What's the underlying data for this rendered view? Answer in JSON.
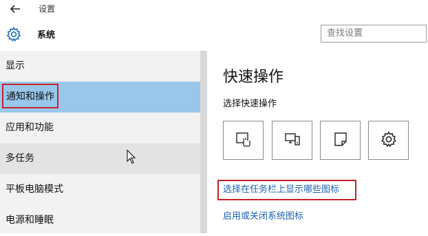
{
  "window": {
    "title": "设置"
  },
  "header": {
    "title": "系统",
    "search_placeholder": "查找设置"
  },
  "sidebar": {
    "items": [
      {
        "label": "显示"
      },
      {
        "label": "通知和操作"
      },
      {
        "label": "应用和功能"
      },
      {
        "label": "多任务"
      },
      {
        "label": "平板电脑模式"
      },
      {
        "label": "电源和睡眠"
      }
    ],
    "selected_index": 1,
    "hover_index": 3
  },
  "main": {
    "title": "快速操作",
    "quick_actions_label": "选择快速操作",
    "quick_actions": [
      {
        "icon": "tablet-mode-icon"
      },
      {
        "icon": "connect-display-icon"
      },
      {
        "icon": "note-icon"
      },
      {
        "icon": "settings-icon"
      }
    ],
    "links": {
      "taskbar_icons": "选择在任务栏上显示哪些图标",
      "system_icons": "启用或关闭系统图标"
    }
  },
  "colors": {
    "sidebar_bg": "#f2f2f2",
    "selected_bg": "#99c7ec",
    "hover_bg": "#e3e3e3",
    "highlight_border": "#c62128",
    "link": "#1a5fb4"
  }
}
